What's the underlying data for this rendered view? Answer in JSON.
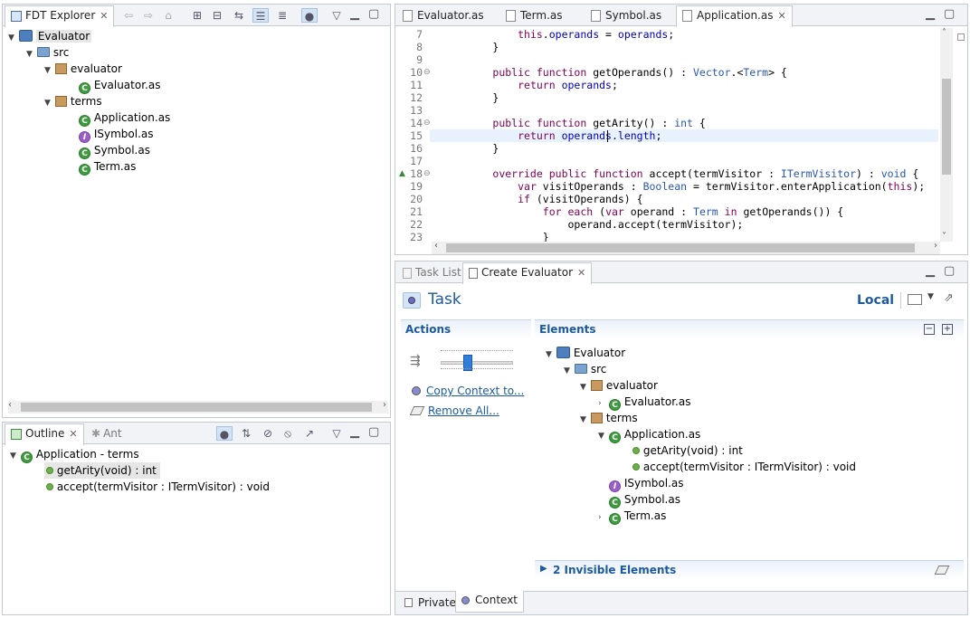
{
  "explorer": {
    "tab_label": "FDT Explorer",
    "tree": [
      {
        "label": "Evaluator",
        "icon": "project-icon"
      },
      {
        "label": "src",
        "icon": "source-folder-icon"
      },
      {
        "label": "evaluator",
        "icon": "package-icon"
      },
      {
        "label": "Evaluator.as",
        "icon": "class-icon"
      },
      {
        "label": "terms",
        "icon": "package-icon"
      },
      {
        "label": "Application.as",
        "icon": "class-icon"
      },
      {
        "label": "ISymbol.as",
        "icon": "interface-icon"
      },
      {
        "label": "Symbol.as",
        "icon": "class-icon"
      },
      {
        "label": "Term.as",
        "icon": "class-icon"
      }
    ]
  },
  "outline": {
    "tab_label": "Outline",
    "tab2_label": "Ant",
    "root": "Application - terms",
    "items": [
      "getArity(void) : int",
      "accept(termVisitor : ITermVisitor) : void"
    ]
  },
  "editor": {
    "tabs": [
      "Evaluator.as",
      "Term.as",
      "Symbol.as",
      "Application.as"
    ],
    "active_tab": "Application.as",
    "line_numbers": [
      "7",
      "8",
      "9",
      "10",
      "11",
      "12",
      "13",
      "14",
      "15",
      "16",
      "17",
      "18",
      "19",
      "20",
      "21",
      "22",
      "23"
    ],
    "lines": [
      "            this.operands = operands;",
      "        }",
      "",
      "        public function getOperands() : Vector.<Term> {",
      "            return operands;",
      "        }",
      "",
      "        public function getArity() : int {",
      "            return operands.length;",
      "        }",
      "",
      "        override public function accept(termVisitor : ITermVisitor) : void {",
      "            var visitOperands : Boolean = termVisitor.enterApplication(this);",
      "            if (visitOperands) {",
      "                for each (var operand : Term in getOperands()) {",
      "                    operand.accept(termVisitor);",
      "                }"
    ]
  },
  "task": {
    "tabs": [
      "Task List",
      "Create Evaluator"
    ],
    "title": "Task",
    "scope": "Local",
    "actions_title": "Actions",
    "elements_title": "Elements",
    "copy_context": "Copy Context to...",
    "remove_all": "Remove All...",
    "elements_tree": [
      "Evaluator",
      "src",
      "evaluator",
      "Evaluator.as",
      "terms",
      "Application.as",
      "getArity(void) : int",
      "accept(termVisitor : ITermVisitor) : void",
      "ISymbol.as",
      "Symbol.as",
      "Term.as"
    ],
    "invisible": "2 Invisible Elements",
    "bottom_tabs": [
      "Private",
      "Context"
    ],
    "slider_level": 0.35
  }
}
